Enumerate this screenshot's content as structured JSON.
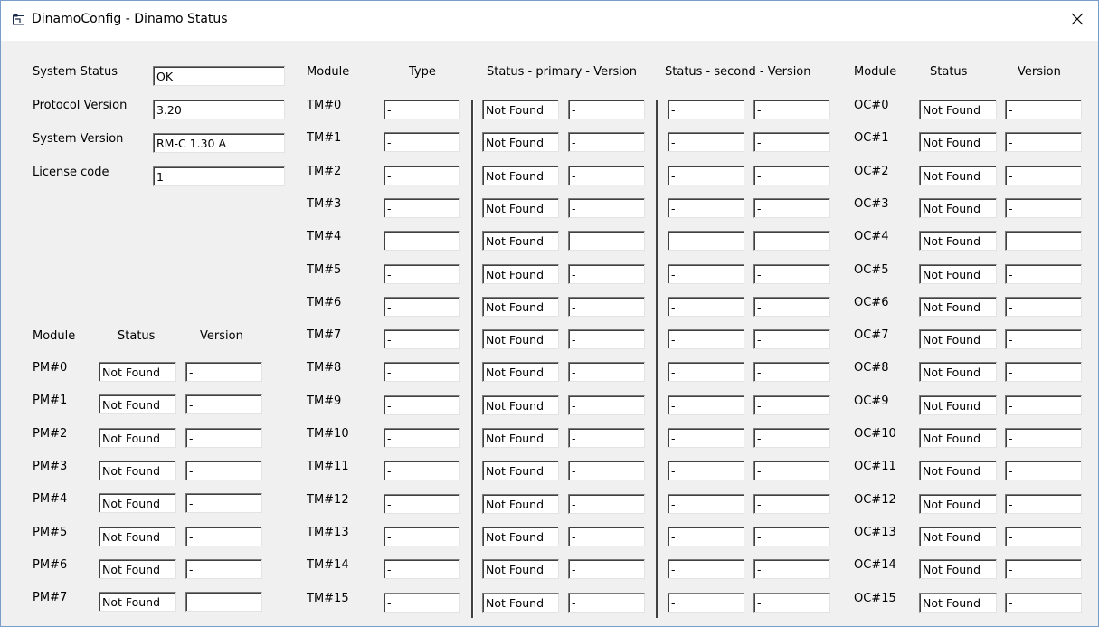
{
  "window": {
    "title": "DinamoConfig - Dinamo Status",
    "icon": "app-window-icon"
  },
  "system": [
    {
      "label": "System Status",
      "value": "OK"
    },
    {
      "label": "Protocol Version",
      "value": "3.20"
    },
    {
      "label": "System Version",
      "value": "RM-C 1.30 A"
    },
    {
      "label": "License code",
      "value": "1"
    }
  ],
  "pm": {
    "headers": {
      "module": "Module",
      "status": "Status",
      "version": "Version"
    },
    "rows": [
      {
        "module": "PM#0",
        "status": "Not Found",
        "version": "-"
      },
      {
        "module": "PM#1",
        "status": "Not Found",
        "version": "-"
      },
      {
        "module": "PM#2",
        "status": "Not Found",
        "version": "-"
      },
      {
        "module": "PM#3",
        "status": "Not Found",
        "version": "-"
      },
      {
        "module": "PM#4",
        "status": "Not Found",
        "version": "-"
      },
      {
        "module": "PM#5",
        "status": "Not Found",
        "version": "-"
      },
      {
        "module": "PM#6",
        "status": "Not Found",
        "version": "-"
      },
      {
        "module": "PM#7",
        "status": "Not Found",
        "version": "-"
      }
    ]
  },
  "tm": {
    "headers": {
      "module": "Module",
      "type": "Type",
      "primary": "Status - primary - Version",
      "second": "Status - second - Version"
    },
    "rows": [
      {
        "module": "TM#0",
        "type": "-",
        "p_status": "Not Found",
        "p_version": "-",
        "s_status": "-",
        "s_version": "-"
      },
      {
        "module": "TM#1",
        "type": "-",
        "p_status": "Not Found",
        "p_version": "-",
        "s_status": "-",
        "s_version": "-"
      },
      {
        "module": "TM#2",
        "type": "-",
        "p_status": "Not Found",
        "p_version": "-",
        "s_status": "-",
        "s_version": "-"
      },
      {
        "module": "TM#3",
        "type": "-",
        "p_status": "Not Found",
        "p_version": "-",
        "s_status": "-",
        "s_version": "-"
      },
      {
        "module": "TM#4",
        "type": "-",
        "p_status": "Not Found",
        "p_version": "-",
        "s_status": "-",
        "s_version": "-"
      },
      {
        "module": "TM#5",
        "type": "-",
        "p_status": "Not Found",
        "p_version": "-",
        "s_status": "-",
        "s_version": "-"
      },
      {
        "module": "TM#6",
        "type": "-",
        "p_status": "Not Found",
        "p_version": "-",
        "s_status": "-",
        "s_version": "-"
      },
      {
        "module": "TM#7",
        "type": "-",
        "p_status": "Not Found",
        "p_version": "-",
        "s_status": "-",
        "s_version": "-"
      },
      {
        "module": "TM#8",
        "type": "-",
        "p_status": "Not Found",
        "p_version": "-",
        "s_status": "-",
        "s_version": "-"
      },
      {
        "module": "TM#9",
        "type": "-",
        "p_status": "Not Found",
        "p_version": "-",
        "s_status": "-",
        "s_version": "-"
      },
      {
        "module": "TM#10",
        "type": "-",
        "p_status": "Not Found",
        "p_version": "-",
        "s_status": "-",
        "s_version": "-"
      },
      {
        "module": "TM#11",
        "type": "-",
        "p_status": "Not Found",
        "p_version": "-",
        "s_status": "-",
        "s_version": "-"
      },
      {
        "module": "TM#12",
        "type": "-",
        "p_status": "Not Found",
        "p_version": "-",
        "s_status": "-",
        "s_version": "-"
      },
      {
        "module": "TM#13",
        "type": "-",
        "p_status": "Not Found",
        "p_version": "-",
        "s_status": "-",
        "s_version": "-"
      },
      {
        "module": "TM#14",
        "type": "-",
        "p_status": "Not Found",
        "p_version": "-",
        "s_status": "-",
        "s_version": "-"
      },
      {
        "module": "TM#15",
        "type": "-",
        "p_status": "Not Found",
        "p_version": "-",
        "s_status": "-",
        "s_version": "-"
      }
    ]
  },
  "oc": {
    "headers": {
      "module": "Module",
      "status": "Status",
      "version": "Version"
    },
    "rows": [
      {
        "module": "OC#0",
        "status": "Not Found",
        "version": "-"
      },
      {
        "module": "OC#1",
        "status": "Not Found",
        "version": "-"
      },
      {
        "module": "OC#2",
        "status": "Not Found",
        "version": "-"
      },
      {
        "module": "OC#3",
        "status": "Not Found",
        "version": "-"
      },
      {
        "module": "OC#4",
        "status": "Not Found",
        "version": "-"
      },
      {
        "module": "OC#5",
        "status": "Not Found",
        "version": "-"
      },
      {
        "module": "OC#6",
        "status": "Not Found",
        "version": "-"
      },
      {
        "module": "OC#7",
        "status": "Not Found",
        "version": "-"
      },
      {
        "module": "OC#8",
        "status": "Not Found",
        "version": "-"
      },
      {
        "module": "OC#9",
        "status": "Not Found",
        "version": "-"
      },
      {
        "module": "OC#10",
        "status": "Not Found",
        "version": "-"
      },
      {
        "module": "OC#11",
        "status": "Not Found",
        "version": "-"
      },
      {
        "module": "OC#12",
        "status": "Not Found",
        "version": "-"
      },
      {
        "module": "OC#13",
        "status": "Not Found",
        "version": "-"
      },
      {
        "module": "OC#14",
        "status": "Not Found",
        "version": "-"
      },
      {
        "module": "OC#15",
        "status": "Not Found",
        "version": "-"
      }
    ]
  }
}
